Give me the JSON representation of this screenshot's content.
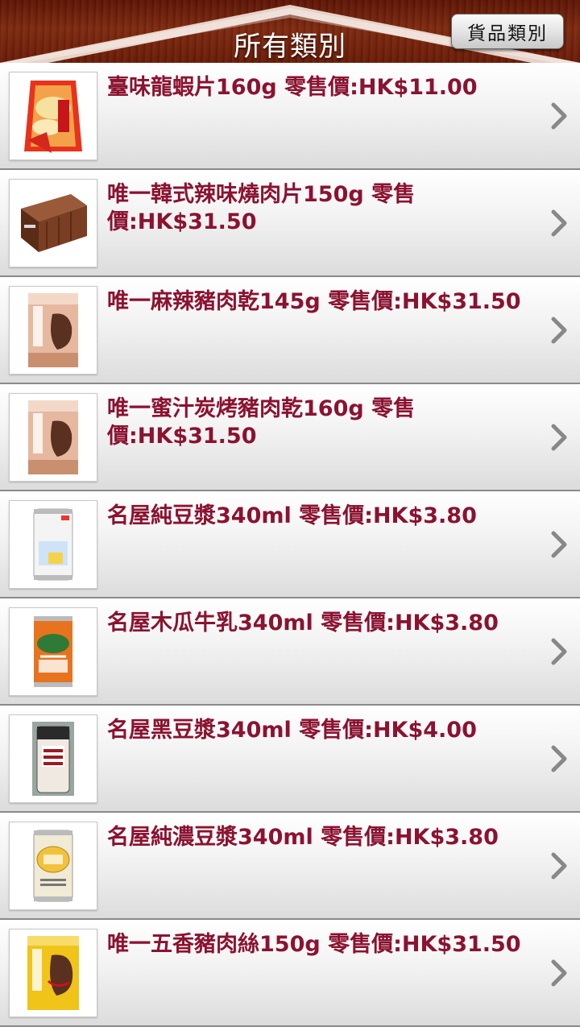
{
  "header": {
    "title": "所有類別",
    "category_button": "貨品類別"
  },
  "products": [
    {
      "name": "臺味龍蝦片160g  零售價:HK$11.00",
      "image_icon": "prawn-cracker-bag-image"
    },
    {
      "name": "唯一韓式辣味燒肉片150g  零售價:HK$31.50",
      "image_icon": "shipping-container-box-image"
    },
    {
      "name": "唯一麻辣豬肉乾145g  零售價:HK$31.50",
      "image_icon": "jerky-package-image"
    },
    {
      "name": "唯一蜜汁炭烤豬肉乾160g  零售價:HK$31.50",
      "image_icon": "jerky-package-image"
    },
    {
      "name": "名屋純豆漿340ml  零售價:HK$3.80",
      "image_icon": "soy-milk-can-image"
    },
    {
      "name": "名屋木瓜牛乳340ml  零售價:HK$3.80",
      "image_icon": "papaya-milk-can-image"
    },
    {
      "name": "名屋黑豆漿340ml  零售價:HK$4.00",
      "image_icon": "black-soybean-can-image"
    },
    {
      "name": "名屋純濃豆漿340ml  零售價:HK$3.80",
      "image_icon": "rich-soy-milk-can-image"
    },
    {
      "name": "唯一五香豬肉絲150g  零售價:HK$31.50",
      "image_icon": "shredded-pork-package-image"
    }
  ],
  "colors": {
    "product_text": "#8b1230",
    "header_wood": "#6a1c08",
    "chevron": "#888888"
  }
}
